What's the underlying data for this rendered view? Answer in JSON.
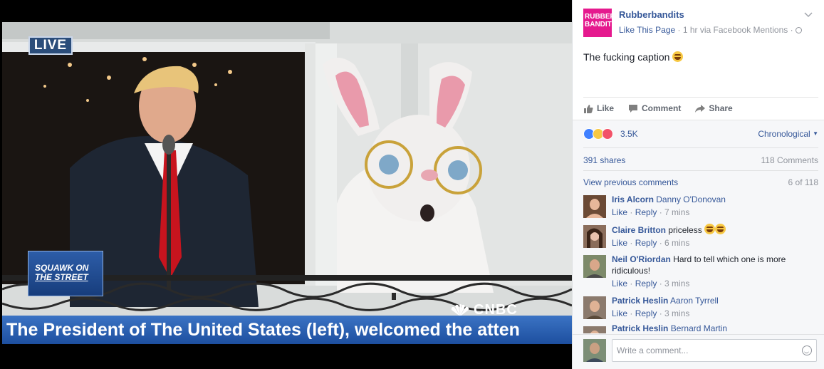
{
  "video": {
    "live_badge": "LIVE",
    "show_logo_line1": "SQUAWK ON",
    "show_logo_line2": "THE STREET",
    "network_logo": "CNBC",
    "ticker_text": "The President of The United States (left), welcomed the atten"
  },
  "post": {
    "page_name": "Rubberbandits",
    "page_avatar_line1": "RUBBER",
    "page_avatar_line2": "BANDITS",
    "like_page": "Like This Page",
    "meta": " · 1 hr via Facebook Mentions · ",
    "caption": "The fucking caption",
    "actions": {
      "like": "Like",
      "comment": "Comment",
      "share": "Share"
    },
    "reaction_count": "3.5K",
    "sort_label": "Chronological",
    "shares": "391 shares",
    "comment_count": "118 Comments",
    "view_previous": "View previous comments",
    "previous_count": "6 of 118"
  },
  "comments": [
    {
      "name": "Iris Alcorn",
      "tag": "Danny O'Donovan",
      "text": "",
      "like": "Like",
      "reply": "Reply",
      "time": "7 mins",
      "avatar_color": "#6b4a35"
    },
    {
      "name": "Claire Britton",
      "tag": "",
      "text": "priceless",
      "like": "Like",
      "reply": "Reply",
      "time": "6 mins",
      "avatar_color": "#8a6d5b"
    },
    {
      "name": "Neil O'Riordan",
      "tag": "",
      "text": "Hard to tell which one is more ridiculous!",
      "like": "Like",
      "reply": "Reply",
      "time": "3 mins",
      "avatar_color": "#7d8a6a"
    },
    {
      "name": "Patrick Heslin",
      "tag": "Aaron Tyrrell",
      "text": "",
      "like": "Like",
      "reply": "Reply",
      "time": "3 mins",
      "avatar_color": "#8b7a6d"
    },
    {
      "name": "Patrick Heslin",
      "tag": "Bernard Martin",
      "text": "",
      "like": "",
      "reply": "",
      "time": "",
      "avatar_color": "#8b7a6d"
    }
  ],
  "composer": {
    "placeholder": "Write a comment..."
  }
}
